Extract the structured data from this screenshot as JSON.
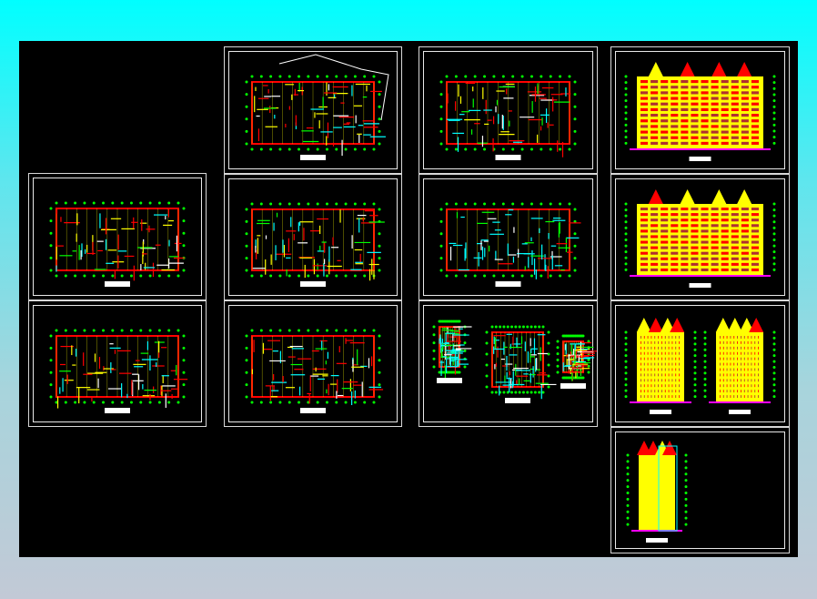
{
  "colors": {
    "canvas": "#000000",
    "frame": "#e0e0e0",
    "wall": "#ff0000",
    "axis": "#ffff00",
    "detail": "#00ffff",
    "dimension": "#00ff00",
    "ground": "#ff00ff"
  },
  "sheets": [
    {
      "id": "plan-a1",
      "kind": "plan"
    },
    {
      "id": "plan-a2",
      "kind": "plan"
    },
    {
      "id": "site-plan",
      "kind": "plan-site"
    },
    {
      "id": "plan-b1",
      "kind": "plan"
    },
    {
      "id": "plan-b2",
      "kind": "plan"
    },
    {
      "id": "plan-c1",
      "kind": "plan"
    },
    {
      "id": "plan-c2",
      "kind": "plan-cyan"
    },
    {
      "id": "roof-details",
      "kind": "details"
    },
    {
      "id": "front-elevation",
      "kind": "elevation"
    },
    {
      "id": "rear-elevation",
      "kind": "elevation"
    },
    {
      "id": "side-elevations",
      "kind": "side-elevation"
    },
    {
      "id": "section",
      "kind": "section"
    }
  ]
}
